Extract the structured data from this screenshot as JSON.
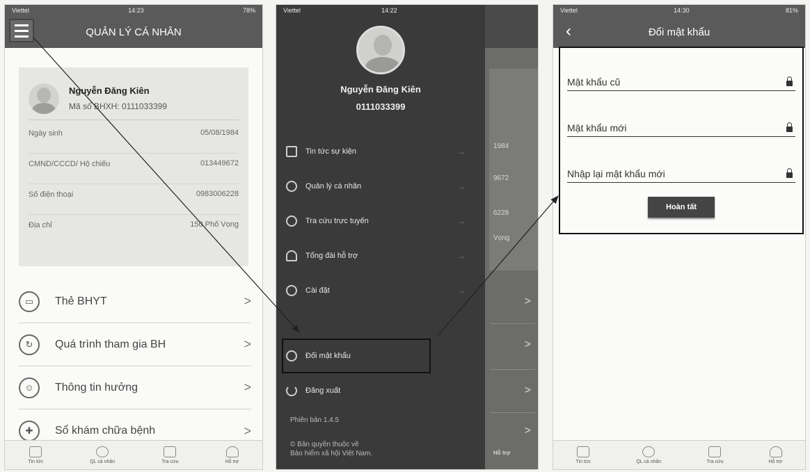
{
  "screen1": {
    "status": {
      "carrier": "Viettel",
      "time": "14:23",
      "battery": "78%"
    },
    "title": "QUẢN LÝ CÁ NHÂN",
    "profile": {
      "name": "Nguyễn Đăng Kiên",
      "id_line": "Mã số BHXH: 0111033399"
    },
    "info": [
      {
        "label": "Ngày sinh",
        "value": "05/08/1984"
      },
      {
        "label": "CMND/CCCD/ Hộ chiếu",
        "value": "013449672"
      },
      {
        "label": "Số điện thoại",
        "value": "0983006228"
      },
      {
        "label": "Địa chỉ",
        "value": "150 Phố Vọng"
      }
    ],
    "menu": [
      {
        "label": "Thẻ BHYT",
        "icon": "card-icon"
      },
      {
        "label": "Quá trình tham gia BH",
        "icon": "history-icon"
      },
      {
        "label": "Thông tin hưởng",
        "icon": "benefit-icon"
      },
      {
        "label": "Sổ khám chữa bệnh",
        "icon": "medical-icon"
      }
    ],
    "nav": [
      "Tin tức",
      "QL cá nhân",
      "Tra cứu",
      "Hỗ trợ"
    ]
  },
  "screen2": {
    "status": {
      "carrier": "Viettel",
      "time": "14:22"
    },
    "profile": {
      "name": "Nguyễn Đăng Kiên",
      "id": "0111033399"
    },
    "menu": [
      {
        "label": "Tin tức sự kiện",
        "icon": "news-icon"
      },
      {
        "label": "Quản lý cá nhân",
        "icon": "profile-icon"
      },
      {
        "label": "Tra cứu trực tuyến",
        "icon": "lookup-icon"
      },
      {
        "label": "Tổng đài hỗ trợ",
        "icon": "support-icon"
      },
      {
        "label": "Cài đặt",
        "icon": "settings-icon"
      }
    ],
    "change_password": "Đổi mật khẩu",
    "logout": "Đăng xuất",
    "version": "Phiên bản 1.4.5",
    "copyright_1": "© Bản quyền thuộc về",
    "copyright_2": "Bảo hiểm xã hội Việt Nam.",
    "behind_values": [
      "1984",
      "9672",
      "6228",
      "Vọng"
    ],
    "behind_nav": "Hỗ trợ"
  },
  "screen3": {
    "status": {
      "carrier": "Viettel",
      "time": "14:30",
      "battery": "81%"
    },
    "title": "Đổi mật khẩu",
    "fields": [
      "Mật khẩu cũ",
      "Mật khẩu mới",
      "Nhập lại mật khẩu mới"
    ],
    "submit": "Hoàn tất",
    "nav": [
      "Tin tức",
      "QL cá nhân",
      "Tra cứu",
      "Hỗ trợ"
    ]
  },
  "colors": {
    "header": "#5a5a5a",
    "drawer": "#3a3a3a",
    "accent": "#444444"
  }
}
